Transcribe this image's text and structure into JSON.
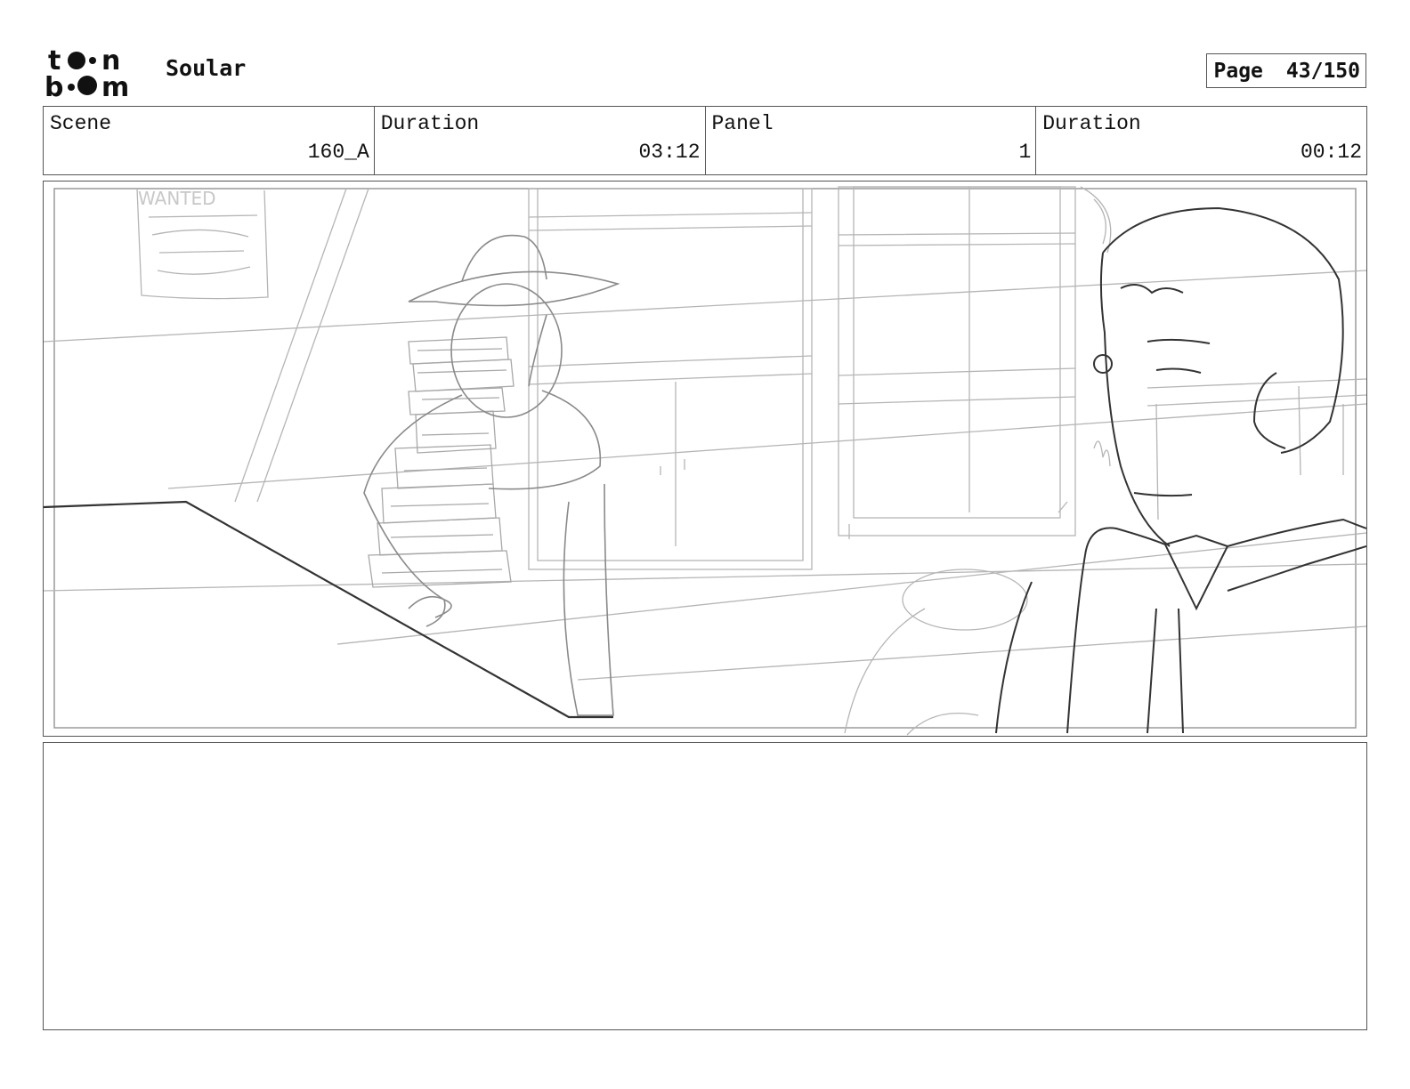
{
  "header": {
    "logo_text": [
      "t●●n",
      "b●●m"
    ],
    "project_title": "Soular",
    "page_label": "Page",
    "page_value": "43/150"
  },
  "info": {
    "scene_label": "Scene",
    "scene_value": "160_A",
    "duration_label": "Duration",
    "duration_value": "03:12",
    "panel_label": "Panel",
    "panel_value": "1",
    "panel_duration_label": "Duration",
    "panel_duration_value": "00:12"
  },
  "sketch": {
    "poster_text": "WANTED"
  },
  "notes": {
    "text": ""
  }
}
